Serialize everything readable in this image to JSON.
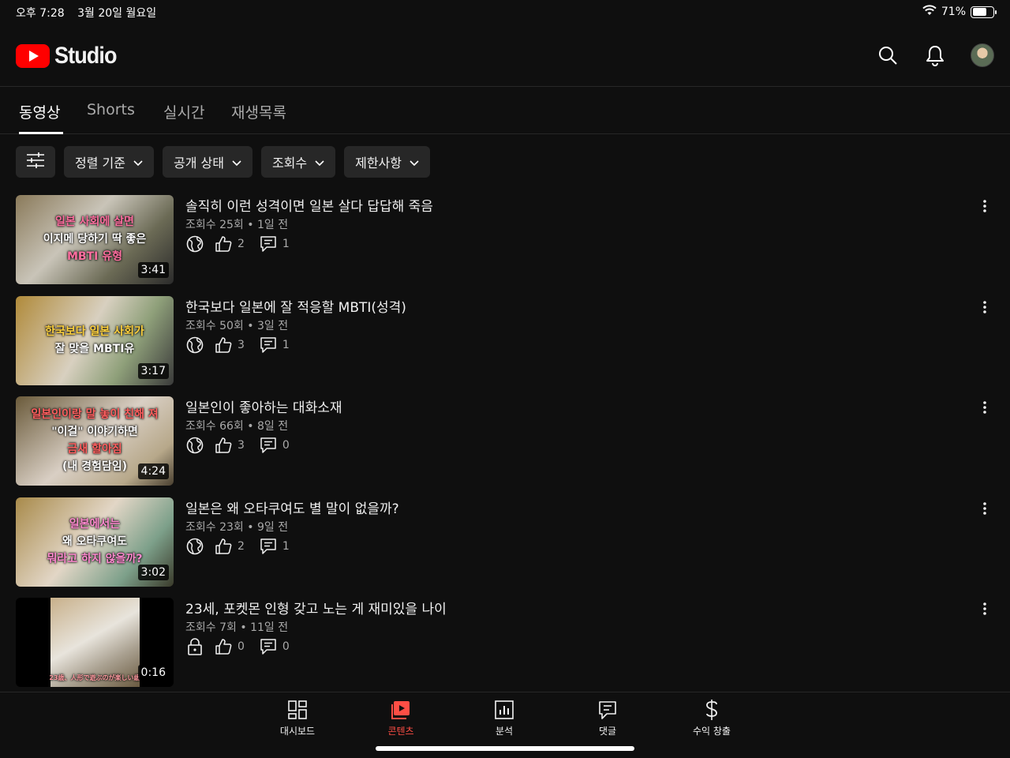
{
  "status_bar": {
    "time": "오후 7:28",
    "date": "3월 20일 월요일",
    "battery": "71%",
    "battery_level": 0.71
  },
  "header": {
    "logo_text": "Studio"
  },
  "tabs": [
    {
      "label": "동영상",
      "active": true
    },
    {
      "label": "Shorts",
      "active": false
    },
    {
      "label": "실시간",
      "active": false
    },
    {
      "label": "재생목록",
      "active": false
    }
  ],
  "filters": [
    "정렬 기준",
    "공개 상태",
    "조회수",
    "제한사항"
  ],
  "videos": [
    {
      "title": "솔직히 이런 성격이면 일본 살다 답답해 죽음",
      "views": "조회수 25회",
      "age": "1일 전",
      "visibility": "public-globe-icon",
      "likes": "2",
      "comments": "1",
      "duration": "3:41",
      "thumb_caption": [
        "일본 사회에 살면",
        "이지메 당하기 딱 좋은",
        "MBTI 유형"
      ]
    },
    {
      "title": "한국보다 일본에 잘 적응할 MBTI(성격)",
      "views": "조회수 50회",
      "age": "3일 전",
      "visibility": "public-globe-icon",
      "likes": "3",
      "comments": "1",
      "duration": "3:17",
      "thumb_caption": [
        "한국보다 일본 사회가",
        "잘 맞을 MBTI유"
      ]
    },
    {
      "title": "일본인이 좋아하는 대화소재",
      "views": "조회수 66회",
      "age": "8일 전",
      "visibility": "public-globe-icon",
      "likes": "3",
      "comments": "0",
      "duration": "4:24",
      "thumb_caption": [
        "일본인이랑 말 놓이 친해 져",
        "\"이걸\" 이야기하면",
        "금새 할아짐",
        "(내 경험담임)"
      ]
    },
    {
      "title": "일본은 왜 오타쿠여도 별 말이 없을까?",
      "views": "조회수 23회",
      "age": "9일 전",
      "visibility": "public-globe-icon",
      "likes": "2",
      "comments": "1",
      "duration": "3:02",
      "thumb_caption": [
        "일본에서는",
        "왜 오타쿠여도",
        "뭐라고 하지 않을까?"
      ]
    },
    {
      "title": "23세, 포켓몬 인형 갖고 노는 게 재미있을 나이",
      "views": "조회수 7회",
      "age": "11일 전",
      "visibility": "private-lock-icon",
      "likes": "0",
      "comments": "0",
      "duration": "0:16",
      "thumb_caption": [
        "23歳、人形で遊ぶのが楽しい歳"
      ]
    }
  ],
  "bottom_nav": [
    {
      "label": "대시보드",
      "icon": "dashboard-icon",
      "active": false
    },
    {
      "label": "콘텐츠",
      "icon": "content-icon",
      "active": true
    },
    {
      "label": "분석",
      "icon": "analytics-icon",
      "active": false
    },
    {
      "label": "댓글",
      "icon": "comments-icon",
      "active": false
    },
    {
      "label": "수익 창출",
      "icon": "monetization-icon",
      "active": false
    }
  ],
  "colors": {
    "background": "#0f0f0f",
    "chip": "#272727",
    "brand_red": "#ff0000",
    "active_nav": "#ff4e45",
    "secondary_text": "#aaaaaa"
  }
}
